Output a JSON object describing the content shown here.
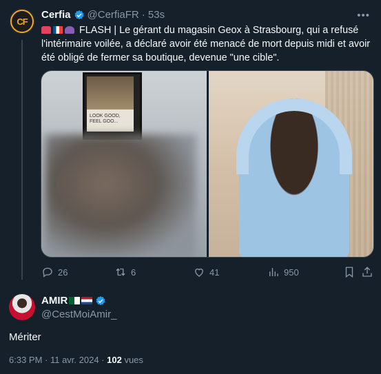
{
  "tweet": {
    "author_name": "Cerfia",
    "author_avatar_text": "CF",
    "author_handle": "@CerfiaFR",
    "time": "· 53s",
    "text": "FLASH | Le gérant du magasin Geox à Strasbourg, qui a refusé l'intérimaire voilée, a déclaré avoir été menacé de mort depuis midi et avoir été obligé de fermer sa boutique, devenue \"une cible\".",
    "poster_caption": "LOOK GOOD, FEEL GOO...",
    "stats": {
      "replies": "26",
      "retweets": "6",
      "likes": "41",
      "views": "950"
    }
  },
  "reply": {
    "author_name": "AMIR",
    "author_handle": "@CestMoiAmir_",
    "text": "Mériter",
    "date": "6:33 PM · 11 avr. 2024 ·",
    "views_count": "102",
    "views_label": "vues"
  },
  "colors": {
    "background": "#15202b",
    "text": "#f7f9f9",
    "muted": "#8b98a5",
    "verified": "#1d9bf0"
  },
  "icons": [
    "reply-icon",
    "retweet-icon",
    "like-icon",
    "views-icon",
    "bookmark-icon",
    "share-icon",
    "verified-icon",
    "more-icon"
  ]
}
